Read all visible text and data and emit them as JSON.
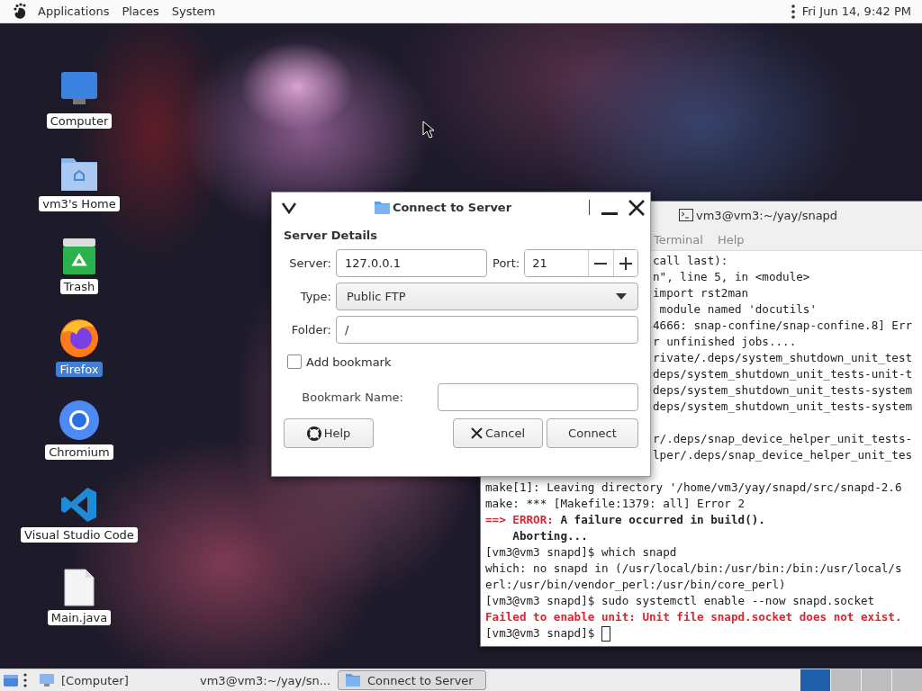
{
  "top_panel": {
    "menus": [
      "Applications",
      "Places",
      "System"
    ],
    "clock": "Fri Jun 14, 9:42 PM"
  },
  "desktop_icons": [
    {
      "label": "Computer",
      "kind": "computer",
      "selected": false
    },
    {
      "label": "vm3's Home",
      "kind": "home",
      "selected": false
    },
    {
      "label": "Trash",
      "kind": "trash",
      "selected": false
    },
    {
      "label": "Firefox",
      "kind": "firefox",
      "selected": true
    },
    {
      "label": "Chromium",
      "kind": "chromium",
      "selected": false
    },
    {
      "label": "Visual Studio Code",
      "kind": "vscode",
      "selected": false
    },
    {
      "label": "Main.java",
      "kind": "file",
      "selected": false
    }
  ],
  "terminal": {
    "title": "vm3@vm3:~/yay/snapd",
    "menus": [
      "Terminal",
      "Help"
    ],
    "covered_blocks": [
      {
        "lines": [
          {
            "text": "call last):"
          },
          {
            "text": "n\", line 5, in <module>"
          },
          {
            "text": "import rst2man"
          },
          {
            "text": " module named 'docutils'"
          },
          {
            "text": "4666: snap-confine/snap-confine.8] Err"
          },
          {
            "text": "r unfinished jobs...."
          },
          {
            "text": "rivate/.deps/system_shutdown_unit_test"
          },
          {
            "text": "deps/system_shutdown_unit_tests-unit-t"
          },
          {
            "text": "deps/system_shutdown_unit_tests-system"
          },
          {
            "text": "deps/system_shutdown_unit_tests-system"
          }
        ]
      },
      {
        "lines": [
          {
            "text": "r/.deps/snap_device_helper_unit_tests-"
          },
          {
            "text": "lper/.deps/snap_device_helper_unit_tes"
          }
        ]
      }
    ],
    "lines": [
      {
        "text": "make[1]: Leaving directory '/home/vm3/yay/snapd/src/snapd-2.6",
        "kind": "plain"
      },
      {
        "text": "make: *** [Makefile:1379: all] Error 2",
        "kind": "plain"
      },
      {
        "parts": [
          {
            "text": "==> ERROR:",
            "kind": "error"
          },
          {
            "text": " A failure occurred in build().",
            "kind": "bold"
          }
        ]
      },
      {
        "text": "    Aborting...",
        "kind": "bold"
      },
      {
        "text": "[vm3@vm3 snapd]$ which snapd",
        "kind": "plain"
      },
      {
        "text": "which: no snapd in (/usr/local/bin:/usr/bin:/bin:/usr/local/s",
        "kind": "plain"
      },
      {
        "text": "erl:/usr/bin/vendor_perl:/usr/bin/core_perl)",
        "kind": "plain"
      },
      {
        "text": "[vm3@vm3 snapd]$ sudo systemctl enable --now snapd.socket",
        "kind": "plain"
      },
      {
        "text": "Failed to enable unit: Unit file snapd.socket does not exist.",
        "kind": "error"
      },
      {
        "text": "[vm3@vm3 snapd]$ ",
        "kind": "plain",
        "cursor": true
      }
    ]
  },
  "dialog": {
    "title": "Connect to Server",
    "section": "Server Details",
    "server": {
      "label": "Server:",
      "value": "127.0.0.1"
    },
    "port": {
      "label": "Port:",
      "value": "21"
    },
    "type": {
      "label": "Type:",
      "value": "Public FTP"
    },
    "folder": {
      "label": "Folder:",
      "value": "/"
    },
    "add_bookmark": {
      "label": "Add bookmark",
      "checked": false
    },
    "bookmark_name": {
      "label": "Bookmark Name:"
    },
    "buttons": [
      {
        "label": "Help",
        "kind": "help"
      },
      {
        "label": "Cancel",
        "kind": "cancel"
      },
      {
        "label": "Connect",
        "kind": "connect"
      }
    ]
  },
  "taskbar": {
    "tasks": [
      {
        "label": "[Computer]",
        "kind": "computer",
        "selected": false
      },
      {
        "label": "vm3@vm3:~/yay/sn...",
        "kind": "terminal",
        "selected": false
      },
      {
        "label": "Connect to Server",
        "kind": "folder",
        "selected": true
      }
    ],
    "workspaces": [
      {
        "selected": true
      },
      {
        "selected": false
      },
      {
        "selected": false
      },
      {
        "selected": false
      }
    ]
  }
}
